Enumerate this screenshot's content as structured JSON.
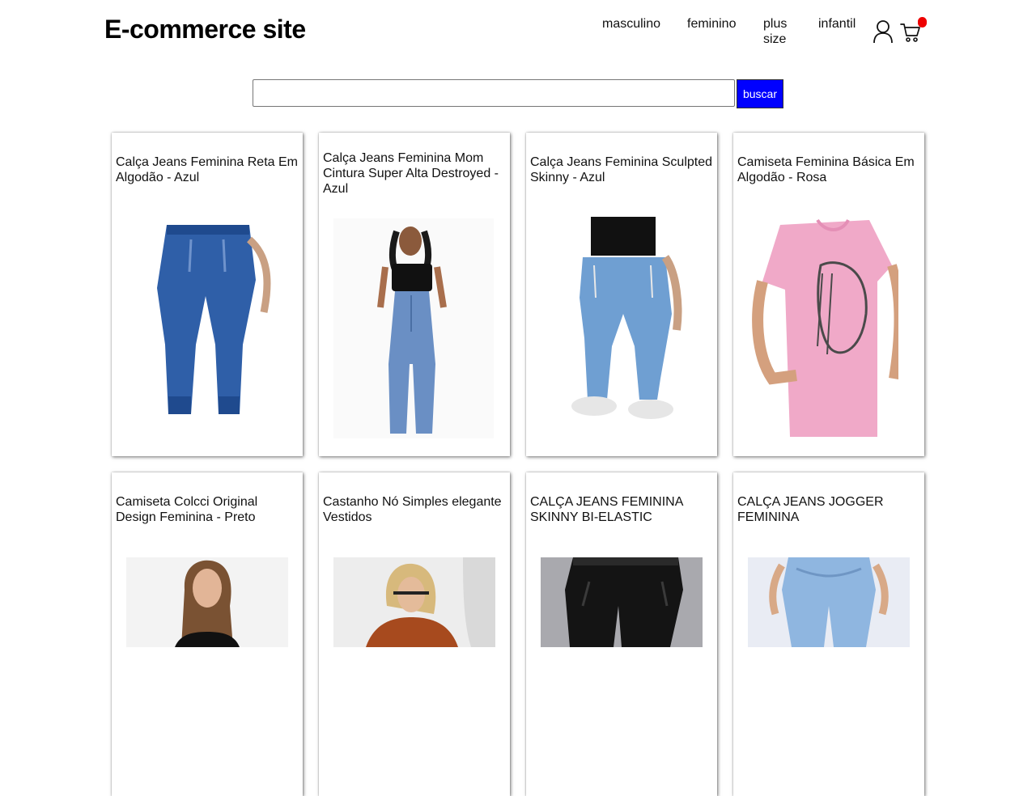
{
  "header": {
    "logo": "E-commerce site",
    "nav": [
      {
        "label": "masculino"
      },
      {
        "label": "feminino"
      },
      {
        "label": "plus size"
      },
      {
        "label": "infantil"
      }
    ],
    "icons": [
      "user-icon",
      "cart-icon"
    ],
    "cart_badge_color": "#ee0000"
  },
  "search": {
    "value": "",
    "placeholder": "",
    "button_label": "buscar",
    "button_color": "#0000ff"
  },
  "products": [
    {
      "title": "Calça Jeans Feminina Reta Em Algodão - Azul",
      "image": "blue-jogger-jeans-photo"
    },
    {
      "title": "Calça Jeans Feminina Mom Cintura Super Alta Destroyed - Azul",
      "image": "model-flare-jeans-photo"
    },
    {
      "title": "Calça Jeans Feminina Sculpted Skinny - Azul",
      "image": "light-jogger-jeans-photo"
    },
    {
      "title": "Camiseta Feminina Básica Em Algodão - Rosa",
      "image": "pink-printed-tshirt-photo"
    },
    {
      "title": "Camiseta Colcci Original Design Feminina - Preto",
      "image": "woman-black-tshirt-photo"
    },
    {
      "title": "Castanho Nó Simples elegante Vestidos",
      "image": "woman-rust-blouse-photo"
    },
    {
      "title": "CALÇA JEANS FEMININA SKINNY BI-ELASTIC",
      "image": "black-leather-pants-photo"
    },
    {
      "title": "CALÇA JEANS JOGGER FEMININA",
      "image": "light-blue-jogger-photo"
    }
  ]
}
